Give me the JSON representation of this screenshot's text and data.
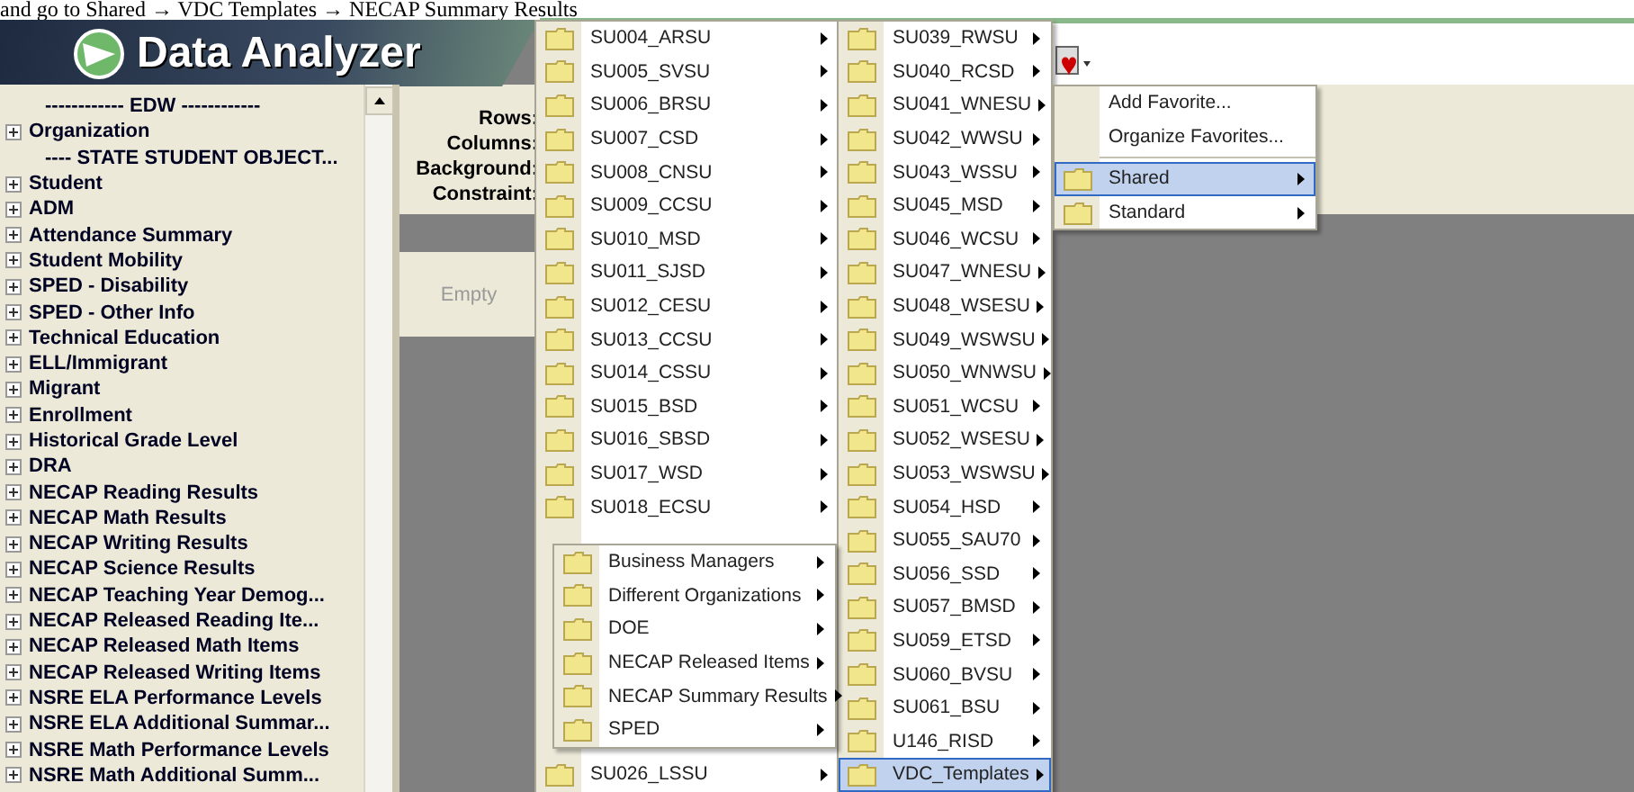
{
  "caption": "and go to Shared → VDC Templates → NECAP Summary Results",
  "app": {
    "title": "Data Analyzer"
  },
  "tree": [
    {
      "label": "------------ EDW ------------",
      "kind": "header"
    },
    {
      "label": "Organization",
      "kind": "group",
      "expanded": false
    },
    {
      "label": "---- STATE STUDENT OBJECT...",
      "kind": "header"
    },
    {
      "label": "Student",
      "kind": "group",
      "expanded": false
    },
    {
      "label": "ADM",
      "kind": "group",
      "expanded": false
    },
    {
      "label": "Attendance Summary",
      "kind": "group",
      "expanded": false
    },
    {
      "label": "Student Mobility",
      "kind": "group",
      "expanded": false
    },
    {
      "label": "SPED - Disability",
      "kind": "group",
      "expanded": false
    },
    {
      "label": "SPED - Other Info",
      "kind": "group",
      "expanded": false
    },
    {
      "label": "Technical Education",
      "kind": "group",
      "expanded": false
    },
    {
      "label": "ELL/Immigrant",
      "kind": "group",
      "expanded": false
    },
    {
      "label": "Migrant",
      "kind": "group",
      "expanded": false
    },
    {
      "label": "Enrollment",
      "kind": "group",
      "expanded": false
    },
    {
      "label": "Historical Grade Level",
      "kind": "group",
      "expanded": false
    },
    {
      "label": "DRA",
      "kind": "group",
      "expanded": false
    },
    {
      "label": "NECAP Reading Results",
      "kind": "group",
      "expanded": false
    },
    {
      "label": "NECAP Math Results",
      "kind": "group",
      "expanded": false
    },
    {
      "label": "NECAP Writing Results",
      "kind": "group",
      "expanded": false
    },
    {
      "label": "NECAP Science Results",
      "kind": "group",
      "expanded": false
    },
    {
      "label": "NECAP Teaching Year Demog...",
      "kind": "group",
      "expanded": false
    },
    {
      "label": "NECAP Released Reading Ite...",
      "kind": "group",
      "expanded": false
    },
    {
      "label": "NECAP Released Math Items",
      "kind": "group",
      "expanded": false
    },
    {
      "label": "NECAP Released Writing Items",
      "kind": "group",
      "expanded": false
    },
    {
      "label": "NSRE ELA Performance Levels",
      "kind": "group",
      "expanded": false
    },
    {
      "label": "NSRE ELA Additional Summar...",
      "kind": "group",
      "expanded": false
    },
    {
      "label": "NSRE Math Performance Levels",
      "kind": "group",
      "expanded": false
    },
    {
      "label": "NSRE Math Additional Summ...",
      "kind": "group",
      "expanded": false
    }
  ],
  "properties": [
    "Rows:",
    "Columns:",
    "Background:",
    "Constraint:"
  ],
  "results": {
    "placeholder": "Empty"
  },
  "favorites_menu": [
    {
      "label": "Add Favorite...",
      "kind": "command",
      "selected": false
    },
    {
      "label": "Organize Favorites...",
      "kind": "command",
      "selected": false
    },
    {
      "label": "Shared",
      "kind": "folder",
      "selected": true
    },
    {
      "label": "Standard",
      "kind": "folder",
      "selected": false
    }
  ],
  "shared_menu_upper": [
    {
      "label": "SU004_ARSU",
      "selected": false
    },
    {
      "label": "SU005_SVSU",
      "selected": false
    },
    {
      "label": "SU006_BRSU",
      "selected": false
    },
    {
      "label": "SU007_CSD",
      "selected": false
    },
    {
      "label": "SU008_CNSU",
      "selected": false
    },
    {
      "label": "SU009_CCSU",
      "selected": false
    },
    {
      "label": "SU010_MSD",
      "selected": false
    },
    {
      "label": "SU011_SJSD",
      "selected": false
    },
    {
      "label": "SU012_CESU",
      "selected": false
    },
    {
      "label": "SU013_CCSU",
      "selected": false
    },
    {
      "label": "SU014_CSSU",
      "selected": false
    },
    {
      "label": "SU015_BSD",
      "selected": false
    },
    {
      "label": "SU016_SBSD",
      "selected": false
    },
    {
      "label": "SU017_WSD",
      "selected": false
    },
    {
      "label": "SU018_ECSU",
      "selected": false
    }
  ],
  "shared_menu_lower": [
    {
      "label": "SU026_LSSU",
      "selected": false
    }
  ],
  "shared_menu_column_2": [
    {
      "label": "SU039_RWSU",
      "selected": false
    },
    {
      "label": "SU040_RCSD",
      "selected": false
    },
    {
      "label": "SU041_WNESU",
      "selected": false
    },
    {
      "label": "SU042_WWSU",
      "selected": false
    },
    {
      "label": "SU043_WSSU",
      "selected": false
    },
    {
      "label": "SU045_MSD",
      "selected": false
    },
    {
      "label": "SU046_WCSU",
      "selected": false
    },
    {
      "label": "SU047_WNESU",
      "selected": false
    },
    {
      "label": "SU048_WSESU",
      "selected": false
    },
    {
      "label": "SU049_WSWSU",
      "selected": false
    },
    {
      "label": "SU050_WNWSU",
      "selected": false
    },
    {
      "label": "SU051_WCSU",
      "selected": false
    },
    {
      "label": "SU052_WSESU",
      "selected": false
    },
    {
      "label": "SU053_WSWSU",
      "selected": false
    },
    {
      "label": "SU054_HSD",
      "selected": false
    },
    {
      "label": "SU055_SAU70",
      "selected": false
    },
    {
      "label": "SU056_SSD",
      "selected": false
    },
    {
      "label": "SU057_BMSD",
      "selected": false
    },
    {
      "label": "SU059_ETSD",
      "selected": false
    },
    {
      "label": "SU060_BVSU",
      "selected": false
    },
    {
      "label": "SU061_BSU",
      "selected": false
    },
    {
      "label": "U146_RISD",
      "selected": false
    },
    {
      "label": "VDC_Templates",
      "selected": true
    }
  ],
  "vdc_templates_menu": [
    {
      "label": "Business Managers",
      "selected": false
    },
    {
      "label": "Different Organizations",
      "selected": false
    },
    {
      "label": "DOE",
      "selected": false
    },
    {
      "label": "NECAP Released Items",
      "selected": false
    },
    {
      "label": "NECAP Summary Results",
      "selected": false
    },
    {
      "label": "SPED",
      "selected": false
    }
  ]
}
